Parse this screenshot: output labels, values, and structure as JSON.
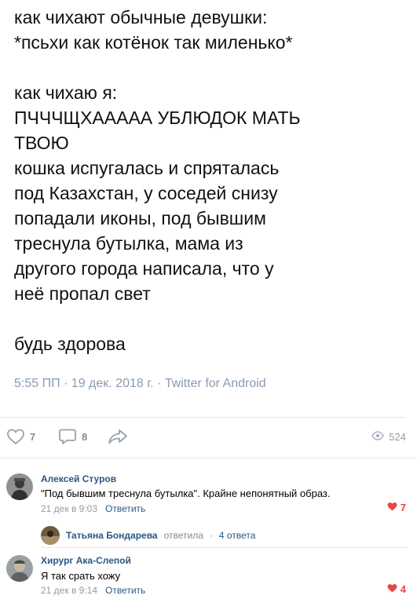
{
  "tweet": {
    "lines": [
      "как чихают обычные девушки:",
      "*псьхи как котёнок так миленько*",
      "",
      "как чихаю я:",
      "ПЧЧЧЩХААААА УБЛЮДОК МАТЬ",
      "ТВОЮ",
      "кошка испугалась и спряталась",
      "под Казахстан, у соседей снизу",
      "попадали иконы, под бывшим",
      "треснула бутылка, мама из",
      "другого города написала, что у",
      "неё пропал свет",
      "",
      "будь здорова"
    ],
    "meta": "5:55 ПП · 19 дек. 2018 г. · Twitter for Android"
  },
  "actions": {
    "likes": "7",
    "comments": "8",
    "views": "524"
  },
  "comments": [
    {
      "author": "Алексей Стуров",
      "text": "\"Под бывшим треснула бутылка\". Крайне непонятный образ.",
      "date": "21 дек в 9:03",
      "reply_label": "Ответить",
      "likes": "7"
    },
    {
      "author": "Хирург Ака-Слепой",
      "text": "Я так срать хожу",
      "date": "21 дек в 9:14",
      "reply_label": "Ответить",
      "likes": "4"
    }
  ],
  "thread": {
    "name": "Татьяна Бондарева",
    "action": "ответила",
    "count": "4 ответа"
  },
  "colors": {
    "link": "#2a5885",
    "muted": "#939cab",
    "like": "#e64646"
  }
}
